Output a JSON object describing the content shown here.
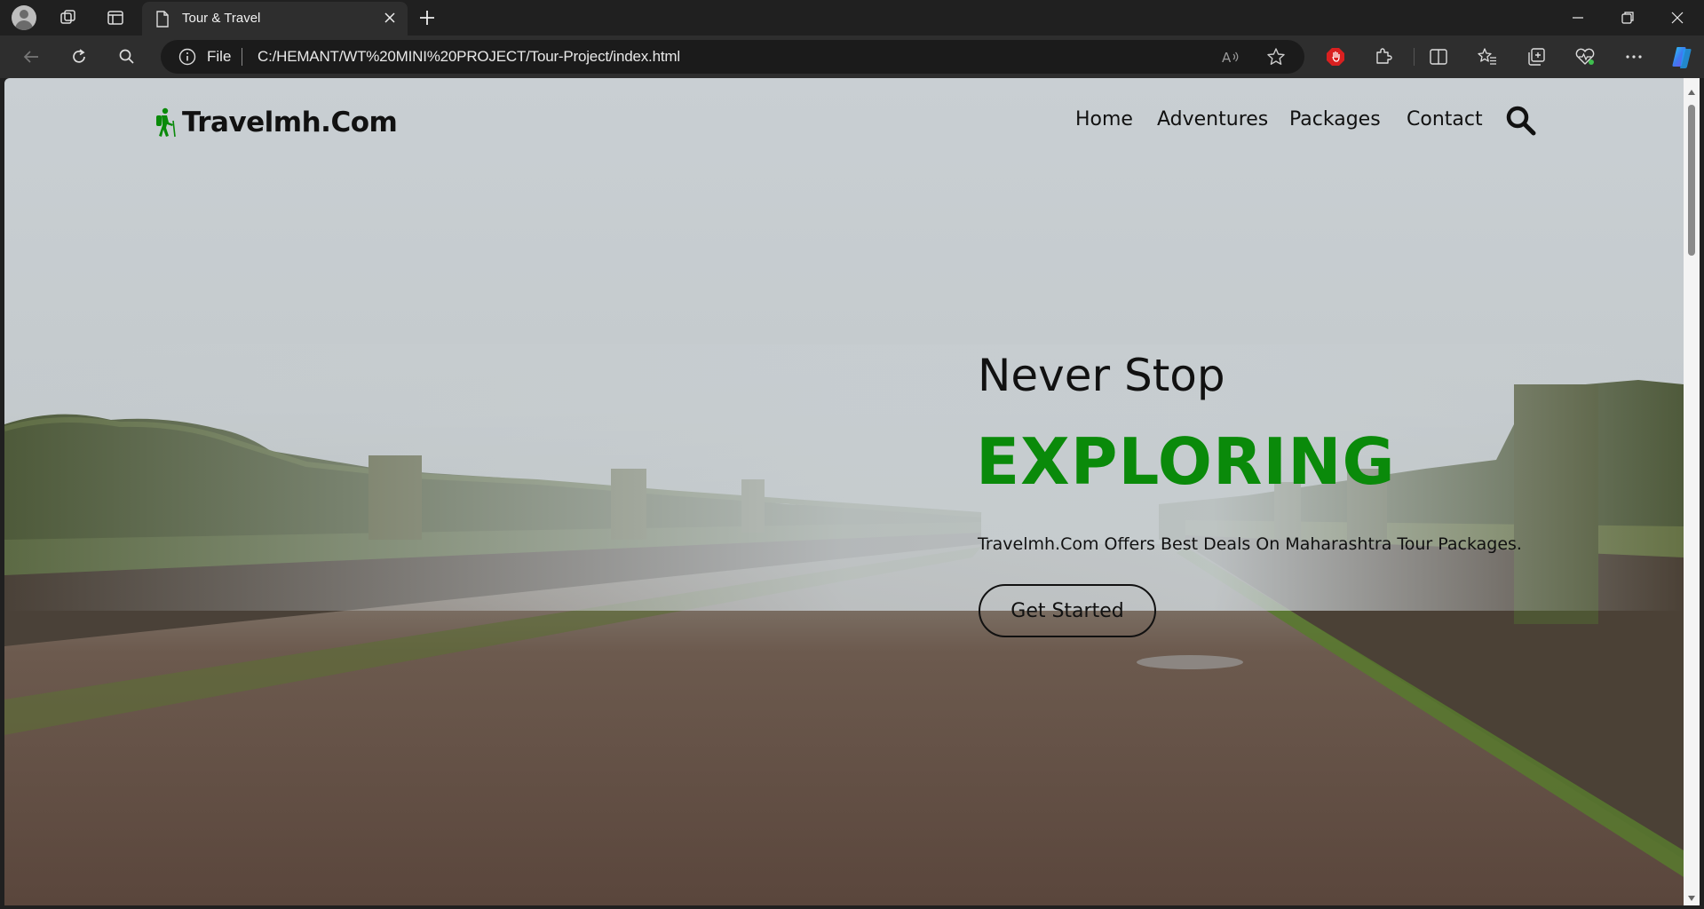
{
  "browser": {
    "tab_title": "Tour & Travel",
    "address_file_label": "File",
    "address_url": "C:/HEMANT/WT%20MINI%20PROJECT/Tour-Project/index.html",
    "icons": [
      "profile-icon",
      "workspaces-icon",
      "tab-actions-icon",
      "page-icon",
      "close-icon",
      "new-tab-icon",
      "minimize-icon",
      "restore-icon",
      "window-close-icon",
      "back-icon",
      "refresh-icon",
      "search-icon",
      "info-icon",
      "read-aloud-icon",
      "favorite-star-icon",
      "adblock-icon",
      "extensions-icon",
      "split-screen-icon",
      "favorites-icon",
      "collections-icon",
      "browser-essentials-icon",
      "more-icon",
      "copilot-icon"
    ]
  },
  "site": {
    "logo_text": "Travelmh.Com",
    "nav": [
      "Home",
      "Adventures",
      "Packages",
      "Contact"
    ],
    "hero": {
      "subtitle": "Never Stop",
      "title": "EXPLORING",
      "description": "Travelmh.Com Offers Best Deals On Maharashtra Tour Packages.",
      "button_label": "Get Started"
    }
  },
  "colors": {
    "accent": "#0a8a0a",
    "text": "#111111",
    "chrome_bg": "#202020",
    "toolbar_bg": "#2e2e2e"
  }
}
